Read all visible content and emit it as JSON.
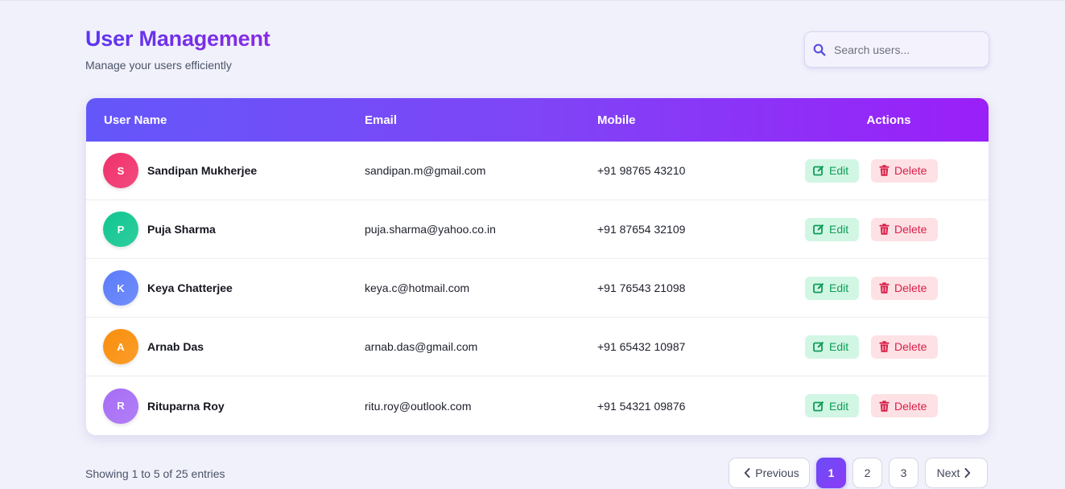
{
  "header": {
    "title": "User Management",
    "subtitle": "Manage your users efficiently"
  },
  "search": {
    "placeholder": "Search users...",
    "icon": "search-icon"
  },
  "table": {
    "columns": [
      "User Name",
      "Email",
      "Mobile",
      "Actions"
    ],
    "rows": [
      {
        "initial": "S",
        "name": "Sandipan Mukherjee",
        "email": "sandipan.m@gmail.com",
        "mobile": "+91 98765 43210"
      },
      {
        "initial": "P",
        "name": "Puja Sharma",
        "email": "puja.sharma@yahoo.co.in",
        "mobile": "+91 87654 32109"
      },
      {
        "initial": "K",
        "name": "Keya Chatterjee",
        "email": "keya.c@hotmail.com",
        "mobile": "+91 76543 21098"
      },
      {
        "initial": "A",
        "name": "Arnab Das",
        "email": "arnab.das@gmail.com",
        "mobile": "+91 65432 10987"
      },
      {
        "initial": "R",
        "name": "Rituparna Roy",
        "email": "ritu.roy@outlook.com",
        "mobile": "+91 54321 09876"
      }
    ],
    "actions": {
      "edit_label": "Edit",
      "delete_label": "Delete"
    }
  },
  "avatar_colors": [
    "#f0306a",
    "#10c690",
    "#5b7cfa",
    "#f98e0b",
    "#a66cf5"
  ],
  "footer": {
    "info": "Showing 1 to 5 of 25 entries",
    "pagination": {
      "previous_label": "Previous",
      "pages": [
        "1",
        "2",
        "3"
      ],
      "active_page": "1",
      "next_label": "Next"
    }
  },
  "colors": {
    "accent": "#7a44f6",
    "edit": "#0f9d58",
    "delete": "#d9204a"
  }
}
